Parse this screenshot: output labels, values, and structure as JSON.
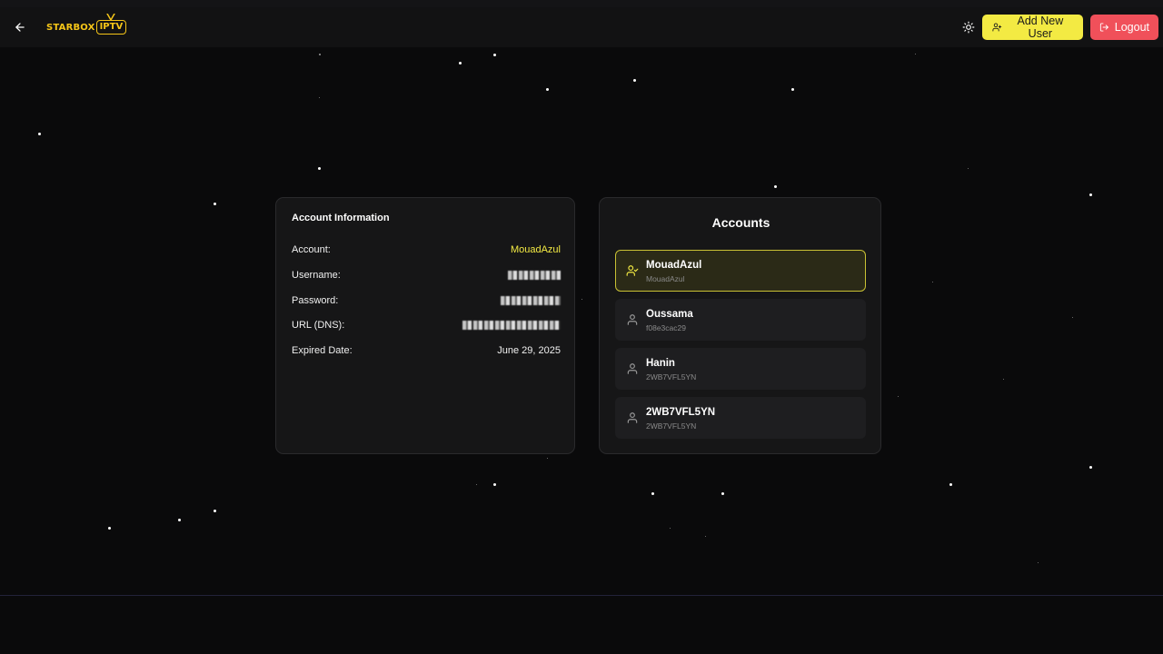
{
  "header": {
    "logo_text": "STARBOX",
    "logo_badge": "IPTV",
    "add_user_label": "Add New User",
    "logout_label": "Logout",
    "icons": {
      "back": "arrow-left-icon",
      "theme": "sun-icon",
      "add_user": "user-plus-icon",
      "logout": "log-out-icon"
    },
    "colors": {
      "add_user_bg": "#f3ea43",
      "logout_bg": "#f0505a"
    }
  },
  "account_info": {
    "title": "Account Information",
    "rows": [
      {
        "label": "Account:",
        "value": "MouadAzul"
      },
      {
        "label": "Username:",
        "value": ""
      },
      {
        "label": "Password:",
        "value": ""
      },
      {
        "label": "URL (DNS):",
        "value": ""
      },
      {
        "label": "Expired Date:",
        "value": "June 29, 2025"
      }
    ]
  },
  "accounts": {
    "title": "Accounts",
    "items": [
      {
        "name": "MouadAzul",
        "sub": "MouadAzul",
        "active": true
      },
      {
        "name": "Oussama",
        "sub": "f08e3cac29",
        "active": false
      },
      {
        "name": "Hanin",
        "sub": "2WB7VFL5YN",
        "active": false
      },
      {
        "name": "2WB7VFL5YN",
        "sub": "2WB7VFL5YN",
        "active": false
      }
    ]
  },
  "accent_color": "#f3ea43"
}
